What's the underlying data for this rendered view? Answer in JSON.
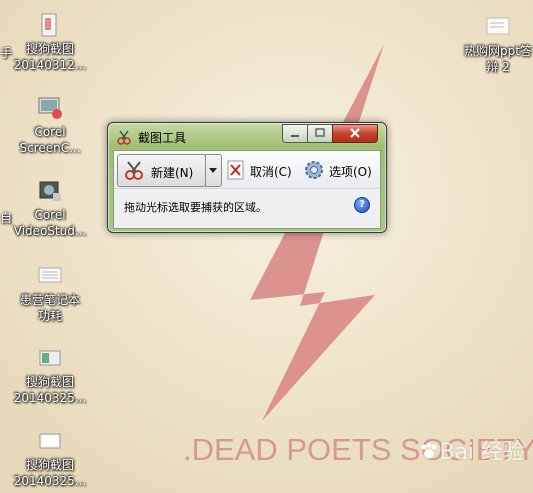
{
  "desktop": {
    "icons": [
      {
        "label_line1": "搜狗截图",
        "label_line2": "20140312..."
      },
      {
        "label_line1": "Corel",
        "label_line2": "ScreenC..."
      },
      {
        "label_line1": "Corel",
        "label_line2": "VideoStud..."
      },
      {
        "label_line1": "患营笔记本",
        "label_line2": "功耗"
      },
      {
        "label_line1": "搜狗截图",
        "label_line2": "20140325..."
      },
      {
        "label_line1": "搜狗截图",
        "label_line2": "20140325..."
      },
      {
        "label_line1": "热购网ppt答",
        "label_line2": "辩 2"
      }
    ],
    "edge_labels": [
      "手",
      "自"
    ],
    "wallpaper_text": ".DEAD POETS SOCIETY",
    "watermark_text": "Bai 经验"
  },
  "snip": {
    "title": "截图工具",
    "new_label": "新建(N)",
    "cancel_label": "取消(C)",
    "options_label": "选项(O)",
    "hint": "拖动光标选取要捕获的区域。",
    "help_glyph": "?"
  },
  "colors": {
    "wallpaper": "#efe4ca",
    "bolt": "#d98a87",
    "frame": "#a9c680"
  }
}
